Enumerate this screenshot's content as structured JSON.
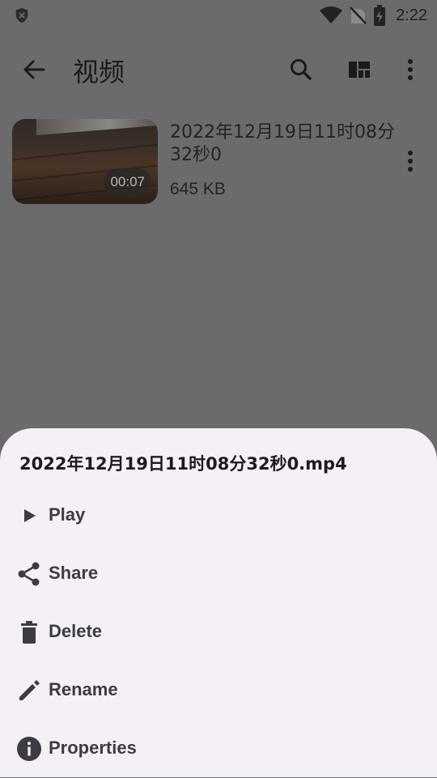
{
  "status_bar": {
    "time": "2:22",
    "icons": [
      "shield-icon",
      "wifi-icon",
      "no-sim-icon",
      "battery-charging-icon"
    ]
  },
  "app_bar": {
    "title": "视频",
    "icons": [
      "back-arrow-icon",
      "search-icon",
      "layout-icon",
      "more-vert-icon"
    ]
  },
  "video_item": {
    "name": "2022年12月19日11时08分32秒0",
    "duration": "00:07",
    "size": "645 KB"
  },
  "sheet": {
    "title": "2022年12月19日11时08分32秒0.mp4",
    "items": [
      {
        "label": "Play",
        "icon": "play-icon"
      },
      {
        "label": "Share",
        "icon": "share-icon"
      },
      {
        "label": "Delete",
        "icon": "delete-icon"
      },
      {
        "label": "Rename",
        "icon": "edit-icon"
      },
      {
        "label": "Properties",
        "icon": "info-icon"
      }
    ]
  },
  "colors": {
    "scrim": "#6b6a6c",
    "sheet_bg": "#f4f0f6",
    "menu_text": "#3e3b44"
  }
}
